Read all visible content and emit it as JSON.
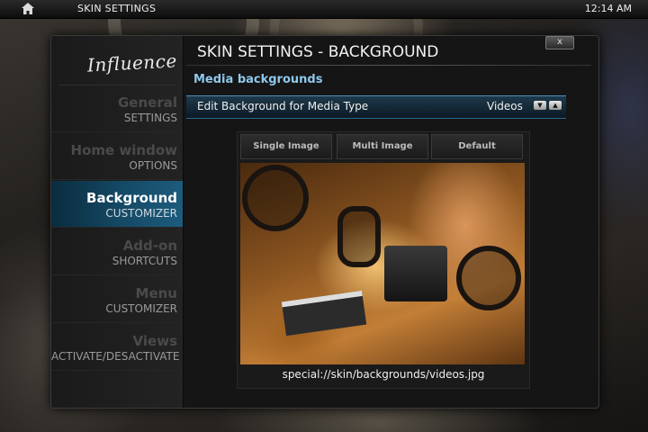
{
  "topbar": {
    "title": "SKIN SETTINGS",
    "clock": "12:14 AM"
  },
  "panel": {
    "logo": "Influence",
    "title": "SKIN SETTINGS - BACKGROUND",
    "close_label": "x"
  },
  "sidebar": {
    "items": [
      {
        "main": "General",
        "sub": "SETTINGS"
      },
      {
        "main": "Home window",
        "sub": "OPTIONS"
      },
      {
        "main": "Background",
        "sub": "CUSTOMIZER"
      },
      {
        "main": "Add-on",
        "sub": "SHORTCUTS"
      },
      {
        "main": "Menu",
        "sub": "CUSTOMIZER"
      },
      {
        "main": "Views",
        "sub": "ACTIVATE/DESACTIVATE"
      }
    ],
    "active_index": 2
  },
  "content": {
    "section_header": "Media backgrounds",
    "setting_label": "Edit Background for Media Type",
    "setting_value": "Videos",
    "spin_down": "▼",
    "spin_up": "▲",
    "options": [
      "Single Image",
      "Multi Image",
      "Default"
    ],
    "preview_path": "special://skin/backgrounds/videos.jpg"
  },
  "colors": {
    "accent": "#8fc8ec",
    "active_bg": "#154a66"
  }
}
